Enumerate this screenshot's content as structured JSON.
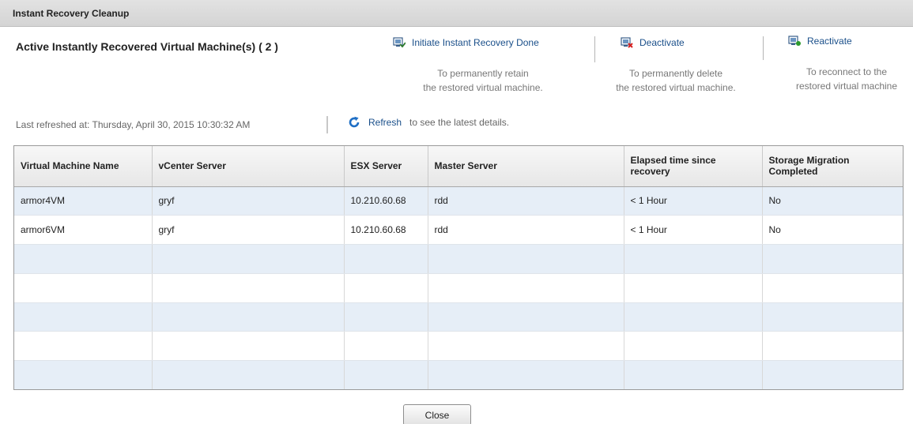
{
  "dialog": {
    "title": "Instant Recovery Cleanup"
  },
  "heading": "Active Instantly Recovered Virtual Machine(s) ( 2 )",
  "actions": [
    {
      "label": "Initiate Instant Recovery Done",
      "desc1": "To permanently retain",
      "desc2": "the restored virtual machine.",
      "icon": "vm-done-icon"
    },
    {
      "label": "Deactivate",
      "desc1": "To permanently delete",
      "desc2": "the restored virtual machine.",
      "icon": "vm-deactivate-icon"
    },
    {
      "label": "Reactivate",
      "desc1": "To reconnect to the",
      "desc2": "restored virtual machine",
      "icon": "vm-reactivate-icon"
    }
  ],
  "refresh": {
    "last_refreshed": "Last refreshed at: Thursday, April 30, 2015 10:30:32 AM",
    "label": "Refresh",
    "desc": "to see the latest details.",
    "icon": "refresh-icon"
  },
  "table": {
    "columns": [
      "Virtual Machine Name",
      "vCenter Server",
      "ESX Server",
      "Master Server",
      "Elapsed time since recovery",
      "Storage Migration Completed"
    ],
    "rows": [
      [
        "armor4VM",
        "gryf",
        "10.210.60.68",
        "rdd",
        "< 1 Hour",
        "No"
      ],
      [
        "armor6VM",
        "gryf",
        "10.210.60.68",
        "rdd",
        "< 1 Hour",
        "No"
      ],
      [
        "",
        "",
        "",
        "",
        "",
        ""
      ],
      [
        "",
        "",
        "",
        "",
        "",
        ""
      ],
      [
        "",
        "",
        "",
        "",
        "",
        ""
      ],
      [
        "",
        "",
        "",
        "",
        "",
        ""
      ],
      [
        "",
        "",
        "",
        "",
        "",
        ""
      ]
    ]
  },
  "footer": {
    "close_label": "Close"
  },
  "colors": {
    "link": "#1a4f8a",
    "row_alt": "#e6eef7",
    "header_bar": "#d4d4d4",
    "delete_red": "#d62020",
    "refresh_blue": "#1f6fc5"
  }
}
